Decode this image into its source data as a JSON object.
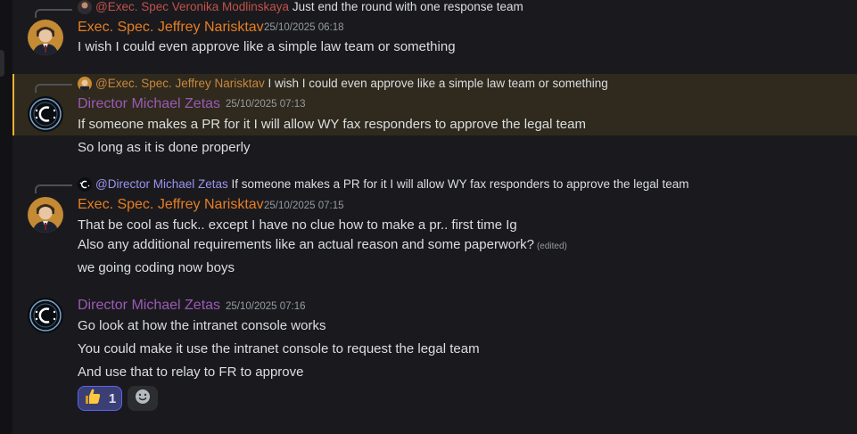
{
  "messages": [
    {
      "reply": {
        "mention": "@Exec. Spec Veronika Modlinskaya",
        "text": "Just end the round with one response team"
      },
      "author": "Exec. Spec. Jeffrey Narisktav",
      "timestamp": "25/10/2025 06:18",
      "lines": [
        "I wish I could even approve like a simple law team or something"
      ]
    },
    {
      "reply": {
        "mention": "@Exec. Spec. Jeffrey Narisktav",
        "text": "I wish I could even approve like a simple law team or something"
      },
      "author": "Director Michael Zetas",
      "timestamp": "25/10/2025 07:13",
      "lines": [
        "If someone makes a PR for it I will allow WY fax responders to approve the legal team",
        "So long as it is done properly"
      ],
      "highlighted": true
    },
    {
      "reply": {
        "mention": "@Director Michael Zetas",
        "text": "If someone makes a PR for it I will allow WY fax responders to approve the legal team"
      },
      "author": "Exec. Spec. Jeffrey Narisktav",
      "timestamp": "25/10/2025 07:15",
      "lines": [
        "That be cool as fuck.. except I have no clue how to make a pr.. first time Ig",
        "Also any additional requirements like an actual reason and some paperwork?",
        "we going coding now boys"
      ],
      "edited_label": "(edited)"
    },
    {
      "author": "Director Michael Zetas",
      "timestamp": "25/10/2025 07:16",
      "lines": [
        "Go look at how the intranet console works",
        "You could make it use the intranet console to request the legal team",
        "And use that to relay to FR to approve"
      ],
      "reaction": {
        "emoji": "thumbs-up-icon",
        "count": "1"
      }
    }
  ],
  "colors": {
    "author_exec": "#e67e22",
    "author_director": "#9b59b6",
    "highlight_bar": "#f0b232",
    "reaction_border": "#5865f2"
  }
}
